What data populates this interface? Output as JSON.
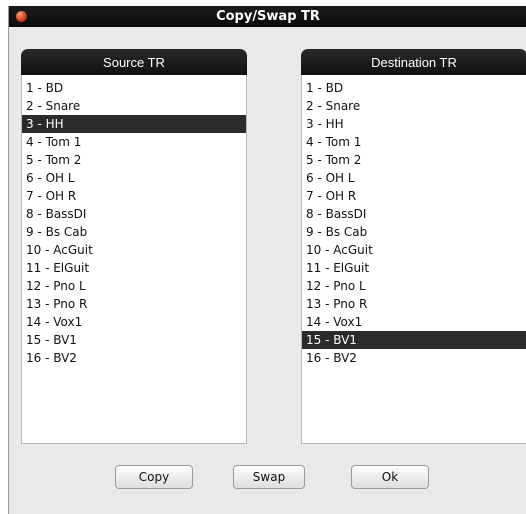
{
  "window": {
    "title": "Copy/Swap TR"
  },
  "source": {
    "header": "Source TR",
    "selected_index": 2,
    "items": [
      "1 - BD",
      "2 - Snare",
      "3 - HH",
      "4 - Tom 1",
      "5 - Tom 2",
      "6 - OH L",
      "7 - OH R",
      "8 - BassDI",
      "9 - Bs Cab",
      "10 - AcGuit",
      "11 - ElGuit",
      "12 - Pno L",
      "13 - Pno R",
      "14 - Vox1",
      "15 - BV1",
      "16 - BV2"
    ]
  },
  "destination": {
    "header": "Destination TR",
    "selected_index": 14,
    "items": [
      "1 - BD",
      "2 - Snare",
      "3 - HH",
      "4 - Tom 1",
      "5 - Tom 2",
      "6 - OH L",
      "7 - OH R",
      "8 - BassDI",
      "9 - Bs Cab",
      "10 - AcGuit",
      "11 - ElGuit",
      "12 - Pno L",
      "13 - Pno R",
      "14 - Vox1",
      "15 - BV1",
      "16 - BV2"
    ]
  },
  "buttons": {
    "copy": "Copy",
    "swap": "Swap",
    "ok": "Ok"
  }
}
